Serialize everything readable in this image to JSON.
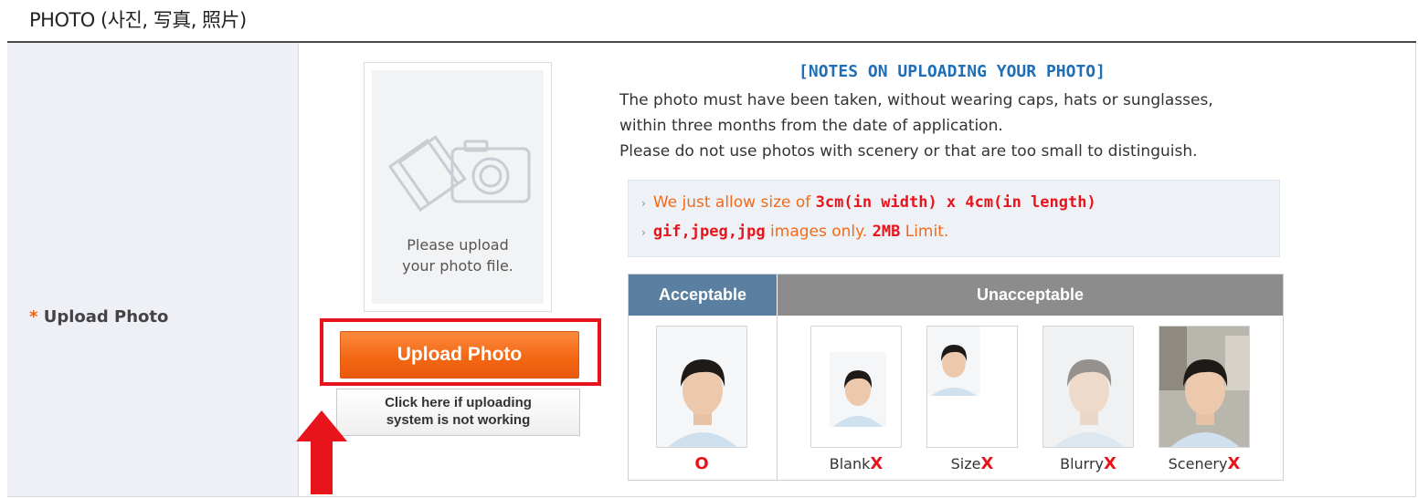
{
  "section": {
    "title": "PHOTO (사진, 写真, 照片)"
  },
  "form": {
    "field_star": "*",
    "field_label": "Upload Photo"
  },
  "photo_placeholder": {
    "icon": "camera-photos-icon",
    "text": "Please upload\nyour photo file."
  },
  "buttons": {
    "upload_label": "Upload Photo",
    "fallback_label": "Click here if uploading\nsystem is not working"
  },
  "annotation": {
    "arrow_icon": "red-up-arrow",
    "highlight_color": "#e8141b"
  },
  "notes": {
    "title": "[NOTES ON UPLOADING YOUR PHOTO]",
    "line1": "The photo must have been taken, without wearing caps, hats or sunglasses,",
    "line2": "within three months from the date of application.",
    "line3": "Please do not use photos with scenery or that are too small to distinguish."
  },
  "rules": {
    "r1_prefix": "We just allow size of ",
    "r1_bold": "3cm(in width) x 4cm(in length)",
    "r2_bold1": "gif,jpeg,jpg",
    "r2_mid": " images only. ",
    "r2_bold2": "2MB",
    "r2_suffix": " Limit."
  },
  "table": {
    "acceptable_header": "Acceptable",
    "unacceptable_header": "Unacceptable",
    "ok_caption": "O",
    "examples": [
      {
        "label": "Blank",
        "mark": "X"
      },
      {
        "label": "Size",
        "mark": "X"
      },
      {
        "label": "Blurry",
        "mark": "X"
      },
      {
        "label": "Scenery",
        "mark": "X"
      }
    ]
  },
  "colors": {
    "accent_orange": "#f26613",
    "notes_blue": "#1f6fb8",
    "error_red": "#e8141b"
  }
}
